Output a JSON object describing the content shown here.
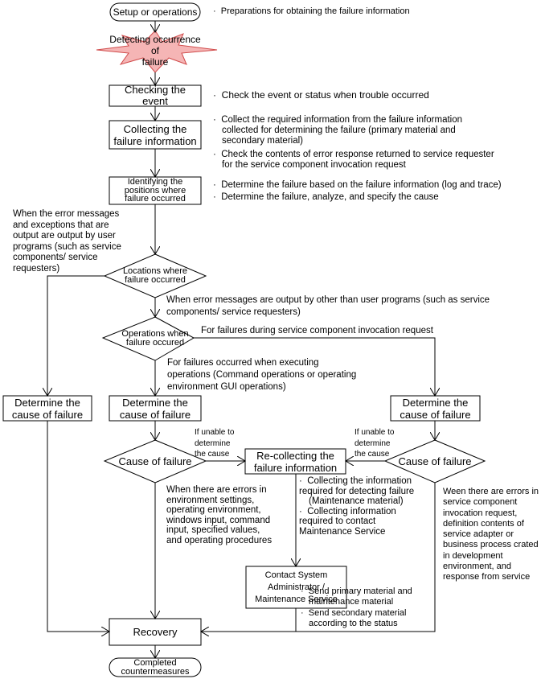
{
  "diagram": {
    "title": "Failure handling procedure flowchart",
    "colors": {
      "line": "#000000",
      "star_fill": "#f5b5b5",
      "star_stroke": "#d04a4a",
      "box_fill": "#ffffff"
    },
    "nodes": {
      "setup": "Setup or operations",
      "detecting": [
        "Detecting occurrence of",
        "failure"
      ],
      "checking": [
        "Checking the",
        "event"
      ],
      "collecting": [
        "Collecting the",
        "failure information"
      ],
      "identifying": [
        "Identifying the",
        "positions where",
        "failure occurred"
      ],
      "locations_decision": [
        "Locations where",
        "failure occurred"
      ],
      "operations_decision": [
        "Operations when",
        "failure occured"
      ],
      "determine_left": [
        "Determine the",
        "cause of failure"
      ],
      "determine_middle": [
        "Determine the",
        "cause of failure"
      ],
      "determine_right": [
        "Determine the",
        "cause of failure"
      ],
      "cause_middle": "Cause of failure",
      "cause_right": "Cause of failure",
      "recollecting": [
        "Re-collecting the",
        "failure information"
      ],
      "contact": [
        "Contact System",
        "Administrator /",
        "Maintenance Service"
      ],
      "recovery": "Recovery",
      "completed": [
        "Completed",
        "countermeasures"
      ]
    },
    "notes": {
      "setup": [
        "Preparations for obtaining the failure information"
      ],
      "checking": [
        "Check the event or status when trouble occurred"
      ],
      "collecting": [
        [
          "Collect the required information from the failure information",
          "collected for determining the failure (primary material and",
          "secondary material)"
        ],
        [
          "Check the contents of error response returned to service requester",
          "for the service component invocation request"
        ]
      ],
      "identifying": [
        "Determine the failure based on the failure information (log and trace)",
        "Determine the failure, analyze, and specify the cause"
      ],
      "recollecting": [
        [
          "Collecting the information",
          "required for detecting failure",
          "(Maintenance material)"
        ],
        [
          "Collecting information",
          "required to contact",
          "Maintenance Service"
        ]
      ],
      "contact": [
        [
          "Send primary material and",
          "maintenance material"
        ],
        [
          "Send secondary material",
          "according to the status"
        ]
      ]
    },
    "bullet": "·",
    "edge_labels": {
      "user_programs": [
        "When the error messages",
        "and exceptions that are",
        "output are output by user",
        "programs (such as service",
        "components/ service",
        "requesters)"
      ],
      "other_than_user": [
        "When error messages are output by other than user programs (such as service",
        "components/ service requesters)"
      ],
      "invocation_request": "For failures during service component invocation request",
      "executing_operations": [
        "For failures occurred when executing",
        "operations (Command operations or operating",
        "environment GUI operations)"
      ],
      "unable_middle": [
        "If unable to",
        "determine",
        "the cause"
      ],
      "unable_right": [
        "If unable to",
        "determine",
        "the cause"
      ],
      "env_errors": [
        "When there are errors in",
        "environment settings,",
        "operating environment,",
        "windows input, command",
        "input, specified values,",
        "and operating procedures"
      ],
      "service_errors": [
        "Ween there are errors in",
        "service component",
        "invocation request,",
        "definition contents of",
        "service adapter or",
        "business process crated",
        "in development",
        "environment, and",
        "response from service"
      ]
    }
  }
}
